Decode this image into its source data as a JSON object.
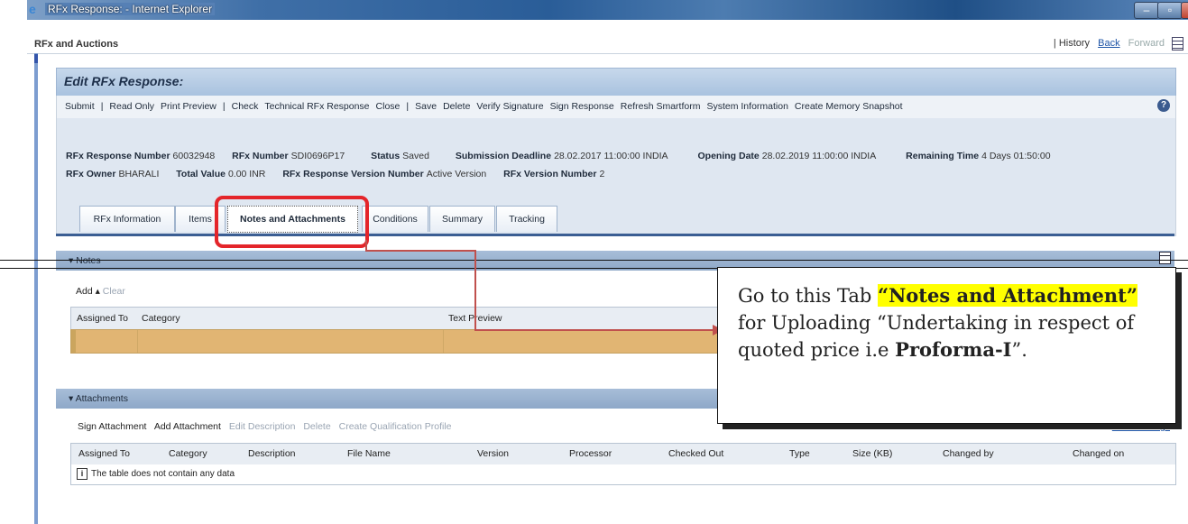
{
  "window": {
    "title": "RFx Response: - Internet Explorer",
    "minimize": "–",
    "maximize": "▫",
    "close": "X"
  },
  "app": {
    "title": "RFx and Auctions",
    "history": "| History",
    "back": "Back",
    "forward": "Forward"
  },
  "page": {
    "title": "Edit RFx Response:"
  },
  "toolbar": {
    "items": [
      "Submit",
      "|",
      "Read Only",
      "Print Preview",
      "|",
      "Check",
      "Technical RFx Response",
      "Close",
      "|",
      "Save",
      "Delete",
      "Verify Signature",
      "Sign Response",
      "Refresh Smartform",
      "System Information",
      "Create Memory Snapshot"
    ]
  },
  "info": {
    "response_number_label": "RFx Response Number",
    "response_number": "60032948",
    "rfx_number_label": "RFx Number",
    "rfx_number": "SDI0696P17",
    "status_label": "Status",
    "status": "Saved",
    "deadline_label": "Submission Deadline",
    "deadline": "28.02.2017 11:00:00 INDIA",
    "opening_label": "Opening Date",
    "opening": "28.02.2019 11:00:00 INDIA",
    "remaining_label": "Remaining Time",
    "remaining": "4 Days 01:50:00",
    "owner_label": "RFx Owner",
    "owner": "BHARALI",
    "total_label": "Total Value",
    "total": "0.00 INR",
    "version_label": "RFx Response Version Number",
    "version": "Active Version",
    "rfx_version_label": "RFx Version Number",
    "rfx_version": "2"
  },
  "tabs": [
    "RFx Information",
    "Items",
    "Notes and Attachments",
    "Conditions",
    "Summary",
    "Tracking"
  ],
  "notes": {
    "header": "▾ Notes",
    "add": "Add ▴",
    "clear": "Clear",
    "columns": [
      "Assigned To",
      "Category",
      "Text Preview"
    ]
  },
  "attachments": {
    "header": "▾ Attachments",
    "tools": [
      "Sign Attachment",
      "Add Attachment",
      "Edit Description",
      "Delete",
      "Create Qualification Profile"
    ],
    "filter": "Filter  Settings",
    "columns": [
      "Assigned To",
      "Category",
      "Description",
      "File Name",
      "Version",
      "Processor",
      "Checked Out",
      "Type",
      "Size (KB)",
      "Changed by",
      "Changed on"
    ],
    "empty": "The table does not contain any data",
    "empty_icon": "i"
  },
  "callout": {
    "pre": "Go to this Tab ",
    "highlight": "“Notes and Attachment”",
    "mid": " for Uploading “Undertaking in respect of quoted price i.e ",
    "bold": "Proforma-I",
    "post": "”."
  },
  "help": "?"
}
